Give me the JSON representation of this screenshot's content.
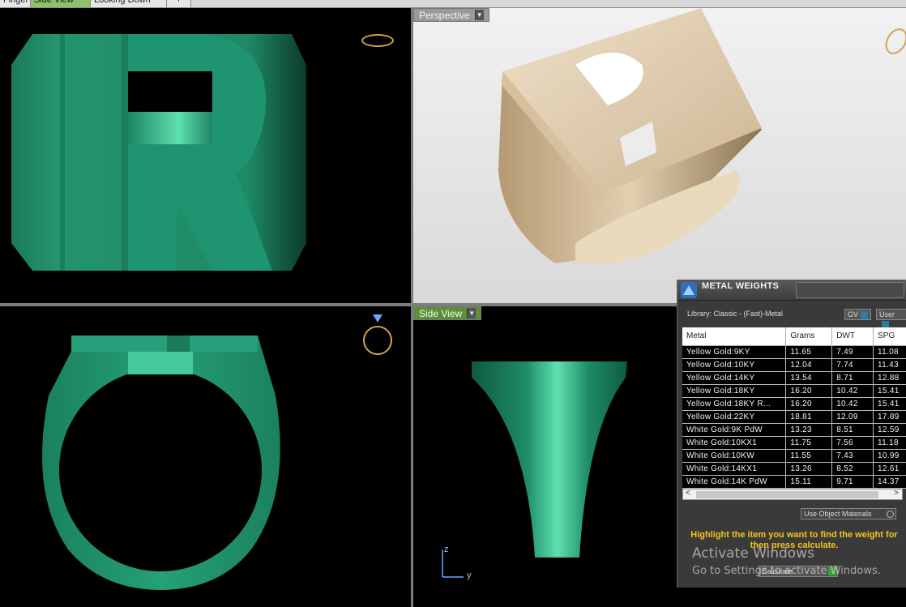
{
  "tabs": [
    {
      "label": "Finger"
    },
    {
      "label": "Side View"
    },
    {
      "label": "Looking Down"
    },
    {
      "label": "+"
    }
  ],
  "viewports": {
    "perspective": {
      "label": "Perspective"
    },
    "side_view": {
      "label": "Side View"
    }
  },
  "axis": {
    "z": "z",
    "y": "y"
  },
  "panel": {
    "title": "METAL WEIGHTS",
    "library": "Library: Classic - (Fast)-Metal",
    "chip_gv": "GV",
    "chip_user": "User",
    "columns": [
      "Metal",
      "Grams",
      "DWT",
      "SPG"
    ],
    "rows": [
      {
        "metal": "Yellow Gold:9KY",
        "grams": "11.65",
        "dwt": "7.49",
        "spg": "11.08"
      },
      {
        "metal": "Yellow Gold:10KY",
        "grams": "12.04",
        "dwt": "7.74",
        "spg": "11.43"
      },
      {
        "metal": "Yellow Gold:14KY",
        "grams": "13.54",
        "dwt": "8.71",
        "spg": "12.88"
      },
      {
        "metal": "Yellow Gold:18KY",
        "grams": "16.20",
        "dwt": "10.42",
        "spg": "15.41"
      },
      {
        "metal": "Yellow Gold:18KY R...",
        "grams": "16.20",
        "dwt": "10.42",
        "spg": "15.41"
      },
      {
        "metal": "Yellow Gold:22KY",
        "grams": "18.81",
        "dwt": "12.09",
        "spg": "17.89"
      },
      {
        "metal": "White Gold:9K PdW",
        "grams": "13.23",
        "dwt": "8.51",
        "spg": "12.59"
      },
      {
        "metal": "White Gold:10KX1",
        "grams": "11.75",
        "dwt": "7.56",
        "spg": "11.18"
      },
      {
        "metal": "White Gold:10KW",
        "grams": "11.55",
        "dwt": "7.43",
        "spg": "10.99"
      },
      {
        "metal": "White Gold:14KX1",
        "grams": "13.26",
        "dwt": "8.52",
        "spg": "12.61"
      },
      {
        "metal": "White Gold:14K PdW",
        "grams": "15.11",
        "dwt": "9.71",
        "spg": "14.37"
      }
    ],
    "scroll_left": "<",
    "scroll_right": ">",
    "use_object_materials": "Use Object Materials",
    "hint": "Highlight the item you want to find the weight for then press calculate.",
    "calculate": "Calculate"
  },
  "watermark": {
    "line1": "Activate Windows",
    "line2": "Go to Settings to activate Windows."
  },
  "colors": {
    "ring_green": "#1f8f6a",
    "ring_gold": "#d8c4a6",
    "hint_yellow": "#f5c518"
  }
}
